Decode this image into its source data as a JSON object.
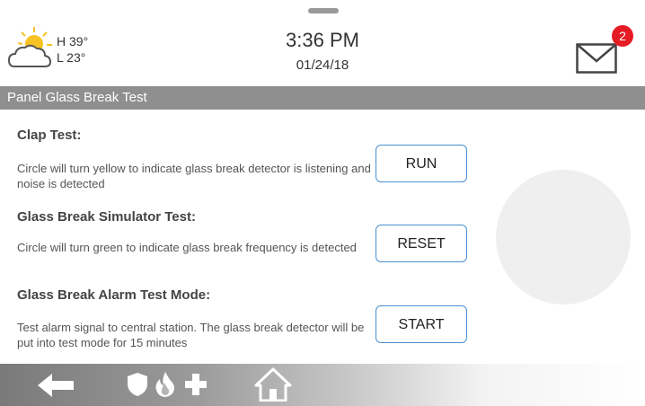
{
  "header": {
    "weather": {
      "high": "H 39°",
      "low": "L 23°",
      "icon": "partly-cloudy-icon"
    },
    "time": "3:36 PM",
    "date": "01/24/18",
    "messages": {
      "count": "2",
      "icon": "envelope-icon"
    }
  },
  "page_title": "Panel Glass Break Test",
  "tests": [
    {
      "heading": "Clap Test:",
      "description": "Circle will turn yellow to indicate glass break detector is listening and noise is detected",
      "button": "RUN"
    },
    {
      "heading": "Glass Break Simulator Test:",
      "description": "Circle will turn green to indicate glass break frequency is detected",
      "button": "RESET"
    },
    {
      "heading": "Glass Break Alarm Test Mode:",
      "description": "Test alarm signal to central station. The glass break detector will be put into test mode for 15 minutes",
      "button": "START"
    }
  ],
  "indicator": {
    "color": "#efefef"
  },
  "nav": {
    "icons": [
      "back-arrow-icon",
      "shield-icon",
      "fire-icon",
      "medical-cross-icon",
      "home-icon"
    ]
  },
  "colors": {
    "title_bar": "#8f8f8f",
    "button_border": "#4a8fd1",
    "badge": "#e51c23"
  }
}
